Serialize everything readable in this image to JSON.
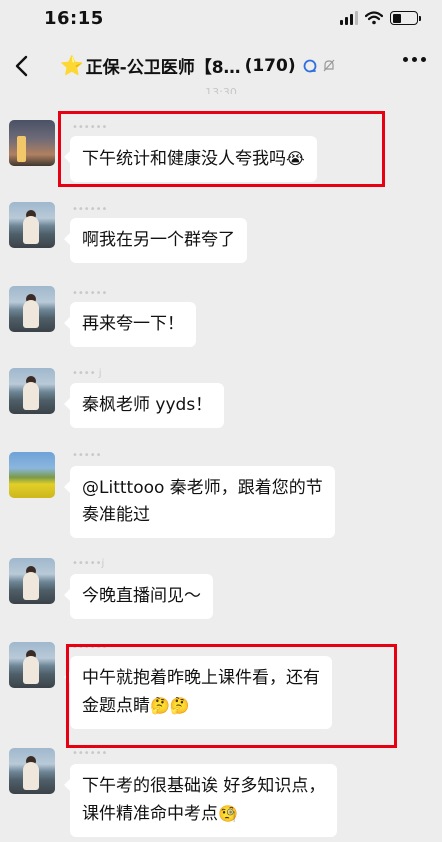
{
  "status_bar": {
    "time": "16:15"
  },
  "header": {
    "title_star": "⭐",
    "title": "正保-公卫医师【8…",
    "member_count": "(170)"
  },
  "timestamp_ghost": "13:30",
  "messages": [
    {
      "nick": "••••••",
      "text": "下午统计和健康没人夸我吗",
      "emoji": "😭",
      "highlighted": true
    },
    {
      "nick": "••••••",
      "text": "啊我在另一个群夸了",
      "emoji": "",
      "highlighted": false
    },
    {
      "nick": "••••••",
      "text": "再来夸一下！",
      "emoji": "",
      "highlighted": false
    },
    {
      "nick": "•••• j",
      "text": "秦枫老师 yyds！",
      "emoji": "",
      "highlighted": false
    },
    {
      "nick": "•••••",
      "line1": "@Litttooo 秦老师，跟着您的节",
      "line2": "奏准能过",
      "highlighted": false
    },
    {
      "nick": "•••••j",
      "text": "今晚直播间见～",
      "emoji": "",
      "highlighted": false
    },
    {
      "nick": "••••••",
      "line1": "中午就抱着昨晚上课件看，还有",
      "line2": "金题点睛",
      "emoji": "🤔🤔",
      "highlighted": true
    },
    {
      "nick": "••••••",
      "line1": "下午考的很基础诶  好多知识点，",
      "line2": "课件精准命中考点",
      "emoji": "🧐",
      "highlighted": false
    }
  ],
  "colors": {
    "highlight": "#e60012",
    "background": "#ededed",
    "bubble": "#ffffff"
  },
  "icons": [
    "back-icon",
    "star-icon",
    "at-mention-icon",
    "mute-bell-icon",
    "more-icon",
    "signal-icon",
    "wifi-icon",
    "battery-icon"
  ]
}
